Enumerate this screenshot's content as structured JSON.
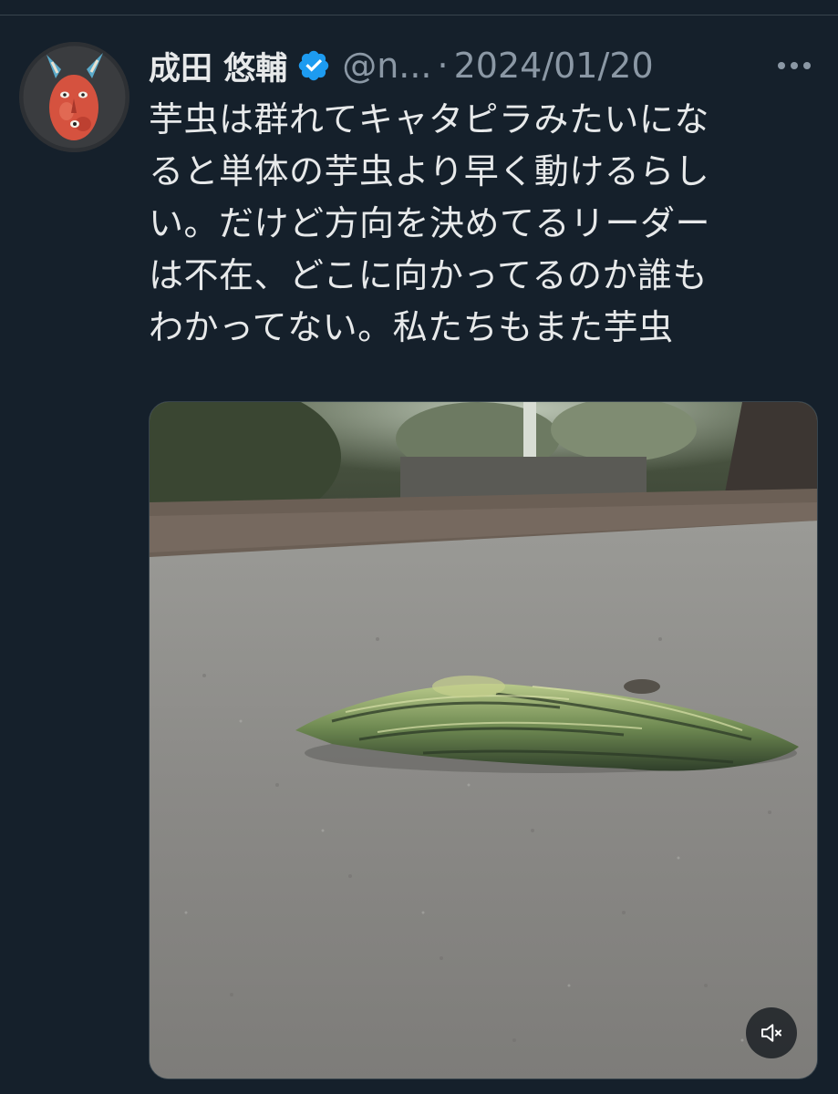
{
  "post": {
    "author": {
      "display_name": "成田 悠輔",
      "handle": "@n...",
      "verified": true,
      "avatar_icon": "mask-avatar-icon"
    },
    "separator": "·",
    "date": "2024/01/20",
    "text": "芋虫は群れてキャタピラみたいにな\nると単体の芋虫より早く動けるらし\nい。だけど方向を決めてるリーダー\nは不在、どこに向かってるのか誰も\nわかってない。私たちもまた芋虫",
    "menu_icon": "more-icon",
    "media": {
      "kind": "video",
      "mute_icon": "volume-muted-icon"
    }
  },
  "colors": {
    "background": "#15202b",
    "primary_text": "#e7e9ea",
    "secondary_text": "#8b98a5",
    "verified_badge": "#1d9bf0"
  }
}
